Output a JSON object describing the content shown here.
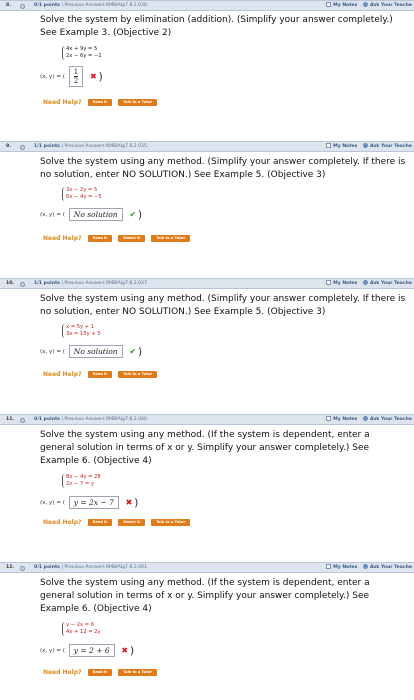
{
  "questions": [
    {
      "number": "8.",
      "points": "0/1 points",
      "meta": "| Previous Answers  KMBIAlg7 8.2.030.",
      "my_notes": "My Notes",
      "ask": "Ask Your Teache",
      "problem": "Solve the system by elimination (addition). (Simplify your answer completely.) See Example 3. (Objective 2)",
      "eq1": "4x + 9y = 5",
      "eq2": "2x − 6y = −1",
      "answer_label": "(x, y) = (",
      "answer_num": "1",
      "answer_den": "2",
      "mark": "✖",
      "need_help": "Need Help?",
      "buttons": [
        "Read It",
        "Talk to a Tutor"
      ]
    },
    {
      "number": "9.",
      "points": "1/1 points",
      "meta": "| Previous Answers  KMBIAlg7 8.2.035.",
      "my_notes": "My Notes",
      "ask": "Ask Your Teache",
      "problem": "Solve the system using any method. (Simplify your answer completely. If there is no solution, enter NO SOLUTION.) See Example 5. (Objective 3)",
      "eq1": "3x − 2y = 5",
      "eq2": "6x − 4y = −5",
      "answer_label": "(x, y) = (",
      "answer": "No solution",
      "mark": "✔",
      "need_help": "Need Help?",
      "buttons": [
        "Read It",
        "Watch It",
        "Talk to a Tutor"
      ]
    },
    {
      "number": "10.",
      "points": "1/1 points",
      "meta": "| Previous Answers  KMBIAlg7 8.2.037.",
      "my_notes": "My Notes",
      "ask": "Ask Your Teache",
      "problem": "Solve the system using any method. (Simplify your answer completely. If there is no solution, enter NO SOLUTION.) See Example 5. (Objective 3)",
      "eq1": "x = 5y + 1",
      "eq2": "3x = 15y + 5",
      "answer_label": "(x, y) = (",
      "answer": "No solution",
      "mark": "✔",
      "need_help": "Need Help?",
      "buttons": [
        "Read It",
        "Talk to a Tutor"
      ]
    },
    {
      "number": "11.",
      "points": "0/1 points",
      "meta": "| Previous Answers  KMBIAlg7 8.2.040.",
      "my_notes": "My Notes",
      "ask": "Ask Your Teache",
      "problem": "Solve the system using any method. (If the system is dependent, enter a general solution in terms of x or y. Simplify your answer completely.) See Example 6. (Objective 4)",
      "eq1": "8x − 4y = 28",
      "eq2": "2x − 7 = y",
      "answer_label": "(x, y) = (",
      "answer": "y = 2x − 7",
      "mark": "✖",
      "need_help": "Need Help?",
      "buttons": [
        "Read It",
        "Watch It",
        "Talk to a Tutor"
      ]
    },
    {
      "number": "12.",
      "points": "0/1 points",
      "meta": "| Previous Answers  KMBIAlg7 8.2.041.",
      "my_notes": "My Notes",
      "ask": "Ask Your Teache",
      "problem": "Solve the system using any method. (If the system is dependent, enter a general solution in terms of x or y. Simplify your answer completely.) See Example 6. (Objective 4)",
      "eq1": "y − 2x = 6",
      "eq2": "4x + 12 = 2y",
      "answer_label": "(x, y) = (",
      "answer": "y = 2 + 6",
      "mark": "✖",
      "need_help": "Need Help?",
      "buttons": [
        "Read It",
        "Talk to a Tutor"
      ]
    }
  ]
}
